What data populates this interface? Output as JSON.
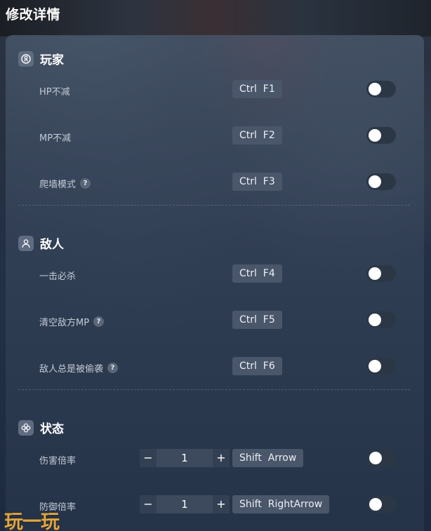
{
  "page_title": "修改详情",
  "sections": {
    "player": {
      "title": "玩家",
      "rows": [
        {
          "label": "HP不减",
          "hotkey": "Ctrl  F1",
          "help": ""
        },
        {
          "label": "MP不减",
          "hotkey": "Ctrl  F2",
          "help": ""
        },
        {
          "label": "爬墙模式",
          "hotkey": "Ctrl  F3",
          "help": "?"
        }
      ]
    },
    "enemy": {
      "title": "敌人",
      "rows": [
        {
          "label": "一击必杀",
          "hotkey": "Ctrl  F4",
          "help": ""
        },
        {
          "label": "清空敌方MP",
          "hotkey": "Ctrl  F5",
          "help": "?"
        },
        {
          "label": "敌人总是被偷袭",
          "hotkey": "Ctrl  F6",
          "help": "?"
        }
      ]
    },
    "status": {
      "title": "状态",
      "rows": [
        {
          "label": "伤害倍率",
          "value": "1",
          "minus": "−",
          "plus": "+",
          "hotkey": "Shift  Arrow"
        },
        {
          "label": "防御倍率",
          "value": "1",
          "minus": "−",
          "plus": "+",
          "hotkey": "Shift  RightArrow"
        }
      ]
    }
  },
  "toggles_on": [
    false,
    false,
    false,
    false,
    false,
    false,
    false,
    false
  ],
  "watermark": "玩一玩",
  "colors": {
    "accent_watermark": "#e2a63b",
    "toggle_track": "#2c3746",
    "hotkey_bg": "#4a566a"
  },
  "icons": {
    "player": "player-icon",
    "enemy": "enemy-icon",
    "status": "status-icon"
  }
}
